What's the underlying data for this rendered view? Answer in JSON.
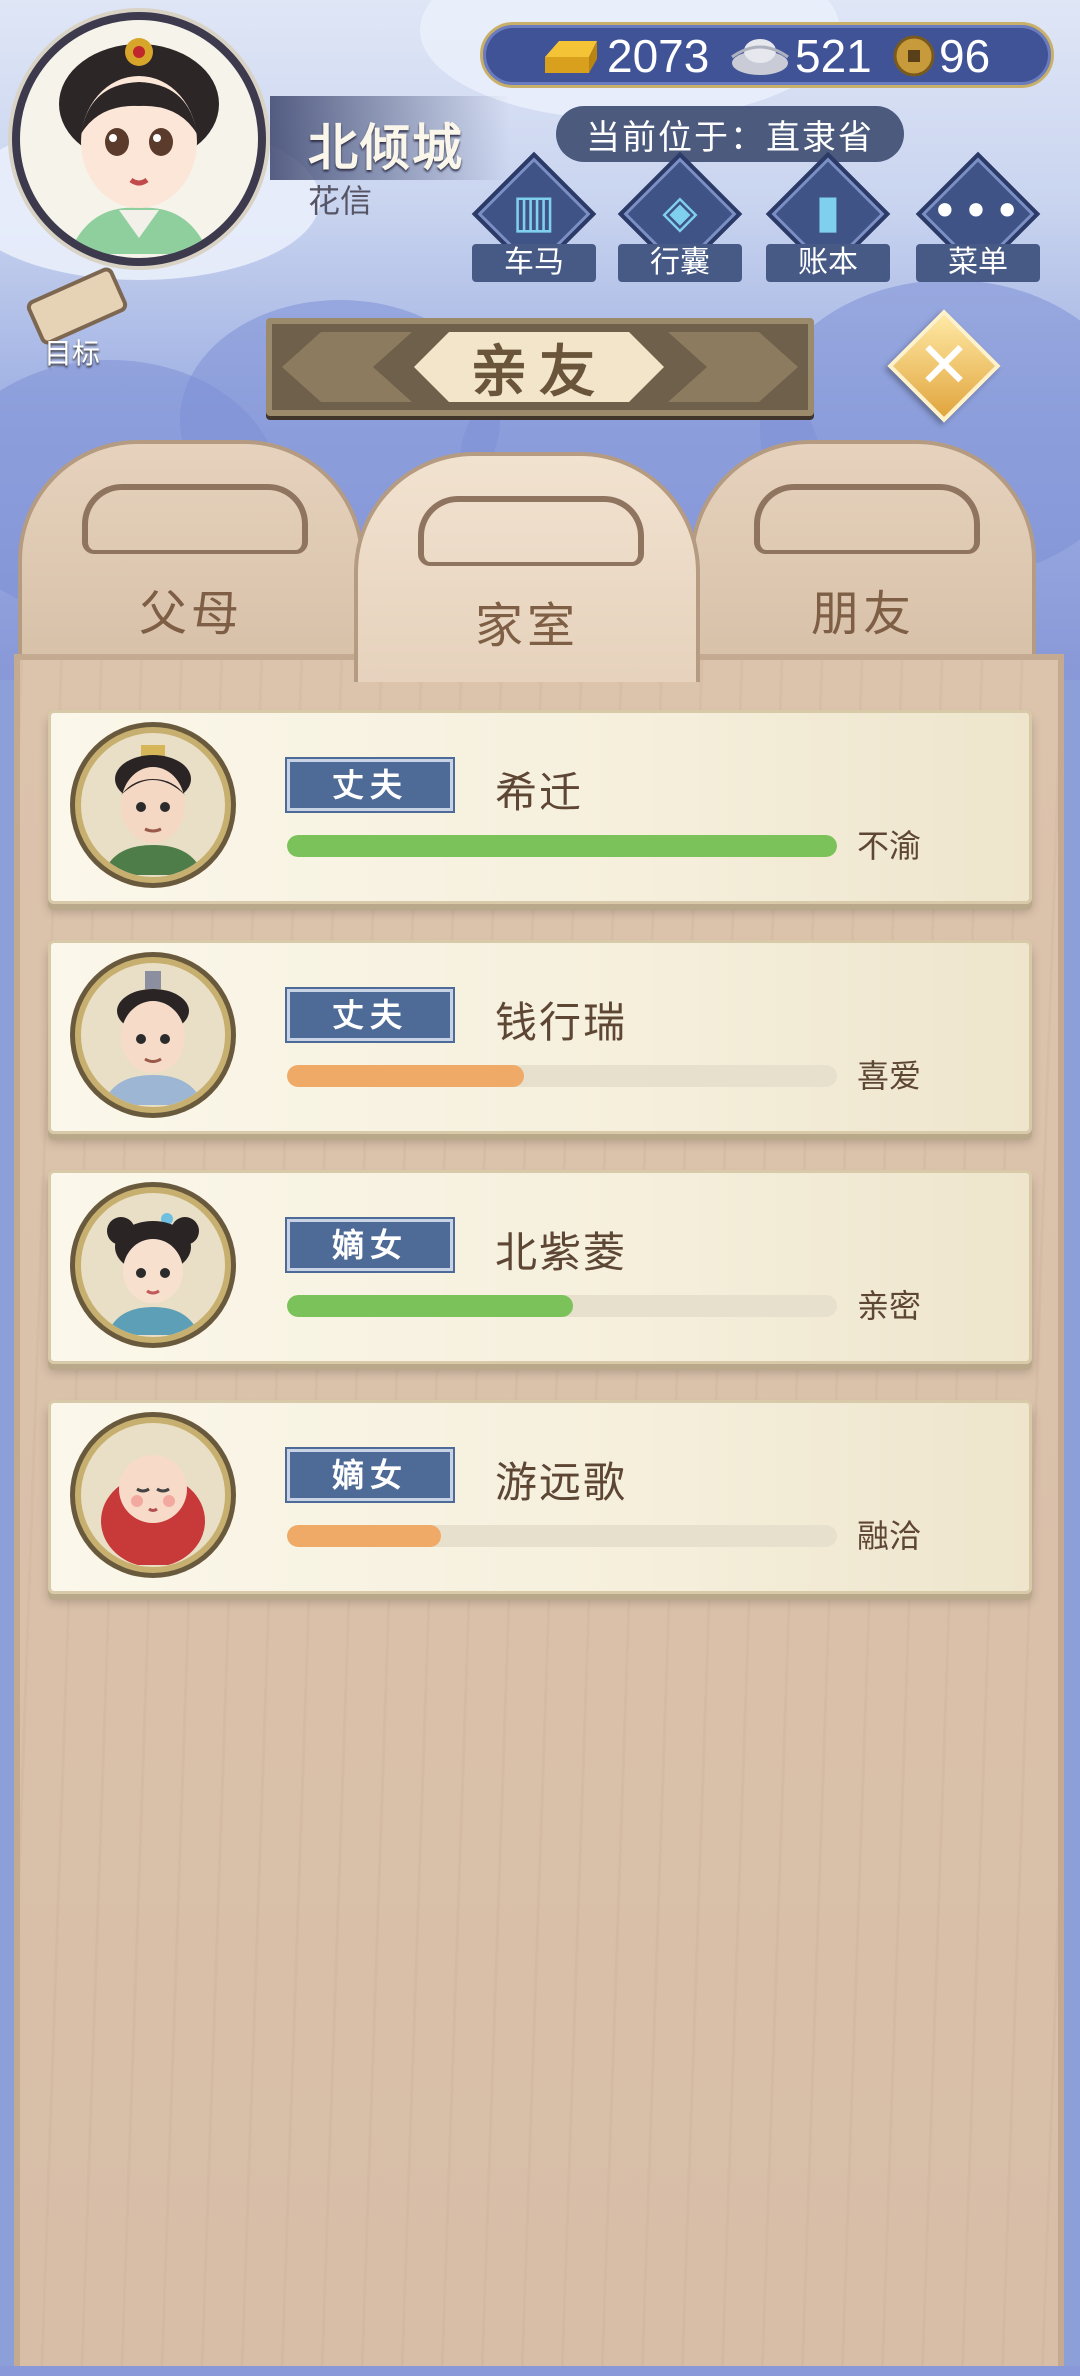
{
  "player": {
    "name": "北倾城",
    "subtitle": "花信"
  },
  "currency": {
    "gold": "2073",
    "silver": "521",
    "coins": "96"
  },
  "location": "当前位于：直隶省",
  "menu": [
    {
      "label": "车马",
      "icon": "carriage-icon"
    },
    {
      "label": "行囊",
      "icon": "bundle-icon"
    },
    {
      "label": "账本",
      "icon": "ledger-icon"
    },
    {
      "label": "菜单",
      "icon": "more-icon"
    }
  ],
  "goal_label": "目标",
  "title": "亲友",
  "tabs": [
    {
      "label": "父母",
      "active": false
    },
    {
      "label": "家室",
      "active": true
    },
    {
      "label": "朋友",
      "active": false
    }
  ],
  "relatives": [
    {
      "role": "丈夫",
      "name": "希迁",
      "relation": "不渝",
      "affinity": 1.0,
      "bar_color": "#7cc25a"
    },
    {
      "role": "丈夫",
      "name": "钱行瑞",
      "relation": "喜爱",
      "affinity": 0.43,
      "bar_color": "#f0aa68"
    },
    {
      "role": "嫡女",
      "name": "北紫菱",
      "relation": "亲密",
      "affinity": 0.52,
      "bar_color": "#7cc25a"
    },
    {
      "role": "嫡女",
      "name": "游远歌",
      "relation": "融洽",
      "affinity": 0.28,
      "bar_color": "#f0aa68"
    }
  ]
}
